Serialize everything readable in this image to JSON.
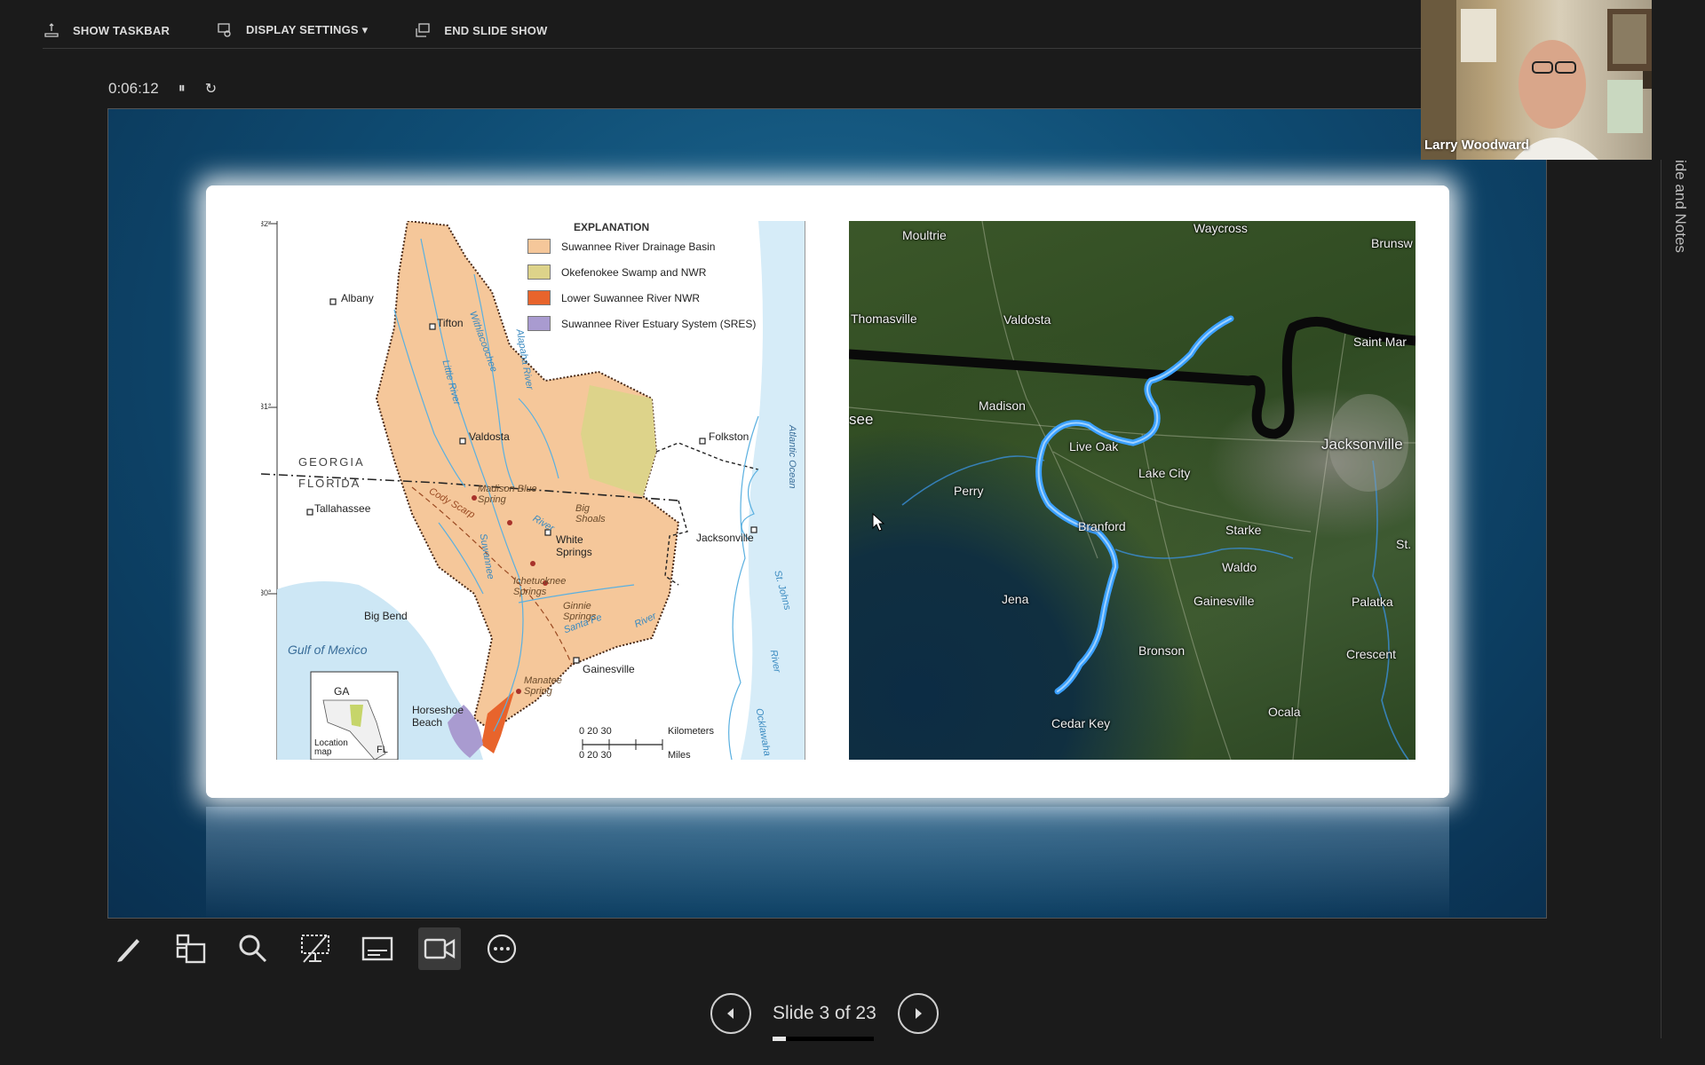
{
  "toolbar": {
    "show_taskbar": "SHOW TASKBAR",
    "display_settings": "DISPLAY SETTINGS ▾",
    "end_slide_show": "END SLIDE SHOW"
  },
  "timer": {
    "elapsed": "0:06:12",
    "pause_glyph": "⏸",
    "reset_glyph": "↻"
  },
  "webcam": {
    "name": "Larry Woodward"
  },
  "side_tab": {
    "label": "ide and Notes"
  },
  "slide_nav": {
    "counter": "Slide 3 of 23",
    "current": 3,
    "total": 23,
    "progress_fraction": 0.13
  },
  "left_map": {
    "legend_title": "EXPLANATION",
    "legend": [
      {
        "label": "Suwannee River Drainage Basin",
        "color": "#f5c79a"
      },
      {
        "label": "Okefenokee Swamp and NWR",
        "color": "#ddd38a"
      },
      {
        "label": "Lower Suwannee River NWR",
        "color": "#e8642c"
      },
      {
        "label": "Suwannee River Estuary System (SRES)",
        "color": "#a99bd0"
      }
    ],
    "states": {
      "georgia": "GEORGIA",
      "florida": "FLORIDA"
    },
    "water": {
      "gulf": "Gulf of Mexico",
      "ocean": "Atlantic Ocean"
    },
    "latitudes": [
      "32°",
      "31°",
      "30°"
    ],
    "towns": {
      "albany": "Albany",
      "tifton": "Tifton",
      "valdosta": "Valdosta",
      "folkston": "Folkston",
      "tallahassee": "Tallahassee",
      "jacksonville": "Jacksonville",
      "white_springs": "White Springs",
      "big_bend": "Big Bend",
      "gainesville": "Gainesville",
      "horseshoe_beach": "Horseshoe Beach"
    },
    "springs": {
      "madison": "Madison Blue Spring",
      "big_shoals": "Big Shoals",
      "ichetucknee": "Ichetucknee Springs",
      "ginnie": "Ginnie Springs",
      "manatee": "Manatee Spring"
    },
    "rivers": {
      "little": "Little River",
      "withlacoochee": "Withlacoochee",
      "alapaha": "Alapaha River",
      "river1": "River",
      "santa_fe": "Santa Fe",
      "river2": "River",
      "st_johns": "St. Johns",
      "river3": "River",
      "ocklawaha": "Ocklawaha",
      "cody_scarp": "Cody Scarp",
      "suwannee": "Suwannee"
    },
    "inset": {
      "ga": "GA",
      "fl": "FL",
      "caption": "Location map"
    },
    "scale": {
      "km_ticks": "0   20   30",
      "km_unit": "Kilometers",
      "mi_ticks": "0       20      30",
      "mi_unit": "Miles"
    }
  },
  "right_map": {
    "labels": {
      "moultrie": "Moultrie",
      "waycross": "Waycross",
      "brunswick": "Brunsw",
      "thomasville": "Thomasville",
      "valdosta": "Valdosta",
      "saint_marys": "Saint Mar",
      "madison": "Madison",
      "see": "see",
      "live_oak": "Live Oak",
      "jacksonville": "Jacksonville",
      "lake_city": "Lake City",
      "perry": "Perry",
      "branford": "Branford",
      "starke": "Starke",
      "st": "St.",
      "waldo": "Waldo",
      "jena": "Jena",
      "gainesville": "Gainesville",
      "palatka": "Palatka",
      "bronson": "Bronson",
      "crescent": "Crescent",
      "ocala": "Ocala",
      "cedar_key": "Cedar Key"
    }
  },
  "colors": {
    "slide_bg": "#0f4d74",
    "river_blue": "#3aa0ff",
    "basin": "#f5c79a"
  }
}
